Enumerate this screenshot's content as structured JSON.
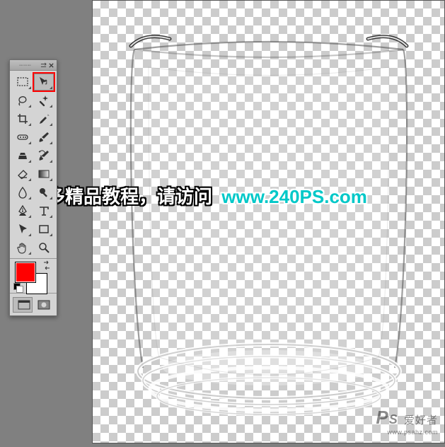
{
  "overlay": {
    "cn_text": "更多精品教程，请访问",
    "url_text": "www.240PS.com"
  },
  "watermark": {
    "brand_prefix": "P",
    "brand_suffix": "S",
    "brand_cn": "爱好者",
    "site": "www.psahz.com"
  },
  "colors": {
    "foreground": "#ff0000",
    "background": "#ffffff",
    "highlight": "#ff0000"
  },
  "tools_panel": {
    "grid_columns": 2,
    "controls": [
      "menu-icon",
      "close-icon"
    ],
    "tools": [
      {
        "id": "marquee",
        "name": "rectangular-marquee-tool",
        "flyout": true,
        "selected": false,
        "highlight": false
      },
      {
        "id": "move",
        "name": "move-tool",
        "flyout": true,
        "selected": true,
        "highlight": true
      },
      {
        "id": "lasso",
        "name": "lasso-tool",
        "flyout": true,
        "selected": false,
        "highlight": false
      },
      {
        "id": "quickselect",
        "name": "quick-selection-tool",
        "flyout": true,
        "selected": false,
        "highlight": false
      },
      {
        "id": "crop",
        "name": "crop-tool",
        "flyout": true,
        "selected": false,
        "highlight": false
      },
      {
        "id": "eyedropper",
        "name": "eyedropper-tool",
        "flyout": true,
        "selected": false,
        "highlight": false
      },
      {
        "id": "heal",
        "name": "spot-healing-brush-tool",
        "flyout": true,
        "selected": false,
        "highlight": false
      },
      {
        "id": "brush",
        "name": "brush-tool",
        "flyout": true,
        "selected": false,
        "highlight": false
      },
      {
        "id": "stamp",
        "name": "clone-stamp-tool",
        "flyout": true,
        "selected": false,
        "highlight": false
      },
      {
        "id": "history",
        "name": "history-brush-tool",
        "flyout": true,
        "selected": false,
        "highlight": false
      },
      {
        "id": "eraser",
        "name": "eraser-tool",
        "flyout": true,
        "selected": false,
        "highlight": false
      },
      {
        "id": "gradient",
        "name": "gradient-tool",
        "flyout": true,
        "selected": false,
        "highlight": false
      },
      {
        "id": "blur",
        "name": "blur-tool",
        "flyout": true,
        "selected": false,
        "highlight": false
      },
      {
        "id": "dodge",
        "name": "dodge-tool",
        "flyout": true,
        "selected": false,
        "highlight": false
      },
      {
        "id": "pen",
        "name": "pen-tool",
        "flyout": true,
        "selected": false,
        "highlight": false
      },
      {
        "id": "type",
        "name": "horizontal-type-tool",
        "flyout": true,
        "selected": false,
        "highlight": false
      },
      {
        "id": "path",
        "name": "path-selection-tool",
        "flyout": true,
        "selected": false,
        "highlight": false
      },
      {
        "id": "shape",
        "name": "rectangle-tool",
        "flyout": true,
        "selected": false,
        "highlight": false
      },
      {
        "id": "hand",
        "name": "hand-tool",
        "flyout": true,
        "selected": false,
        "highlight": false
      },
      {
        "id": "zoom",
        "name": "zoom-tool",
        "flyout": false,
        "selected": false,
        "highlight": false
      }
    ],
    "screen_modes": [
      {
        "id": "standard",
        "name": "standard-screen-mode",
        "flyout": true,
        "selected": true
      },
      {
        "id": "mask",
        "name": "quick-mask-mode",
        "flyout": false,
        "selected": false
      }
    ]
  },
  "canvas": {
    "content_description": "transparent-glass-cup-on-checkerboard"
  }
}
